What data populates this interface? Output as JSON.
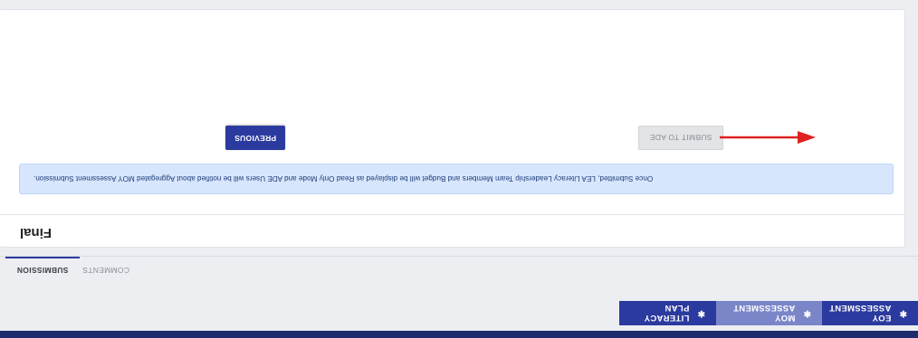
{
  "report_tabs": [
    {
      "label": "EOY ASSESSMENT",
      "icon": "star-icon"
    },
    {
      "label": "MOY ASSESSMENT",
      "icon": "star-icon"
    },
    {
      "label": "LITERACY PLAN",
      "icon": "star-icon"
    }
  ],
  "sub_tabs": {
    "submission": "SUBMISSION",
    "comments": "COMMENTS"
  },
  "card": {
    "title": "Final",
    "alert_text": "Once Submitted, LEA Literacy Leadership Team Members and Budget will be displayed as Read Only Mode and ADE Users will be notified about Aggregated MOY Assessment Submission.",
    "previous_label": "PREVIOUS",
    "submit_label": "SUBMIT TO ADE"
  },
  "colors": {
    "primary": "#2b3a9e",
    "active_tab": "#7b86c9",
    "alert_bg": "#d7e6fc",
    "arrow": "#e02020",
    "top_bar": "#1f2b6c"
  },
  "icons": {
    "tab_icon_glyph": "✱"
  }
}
